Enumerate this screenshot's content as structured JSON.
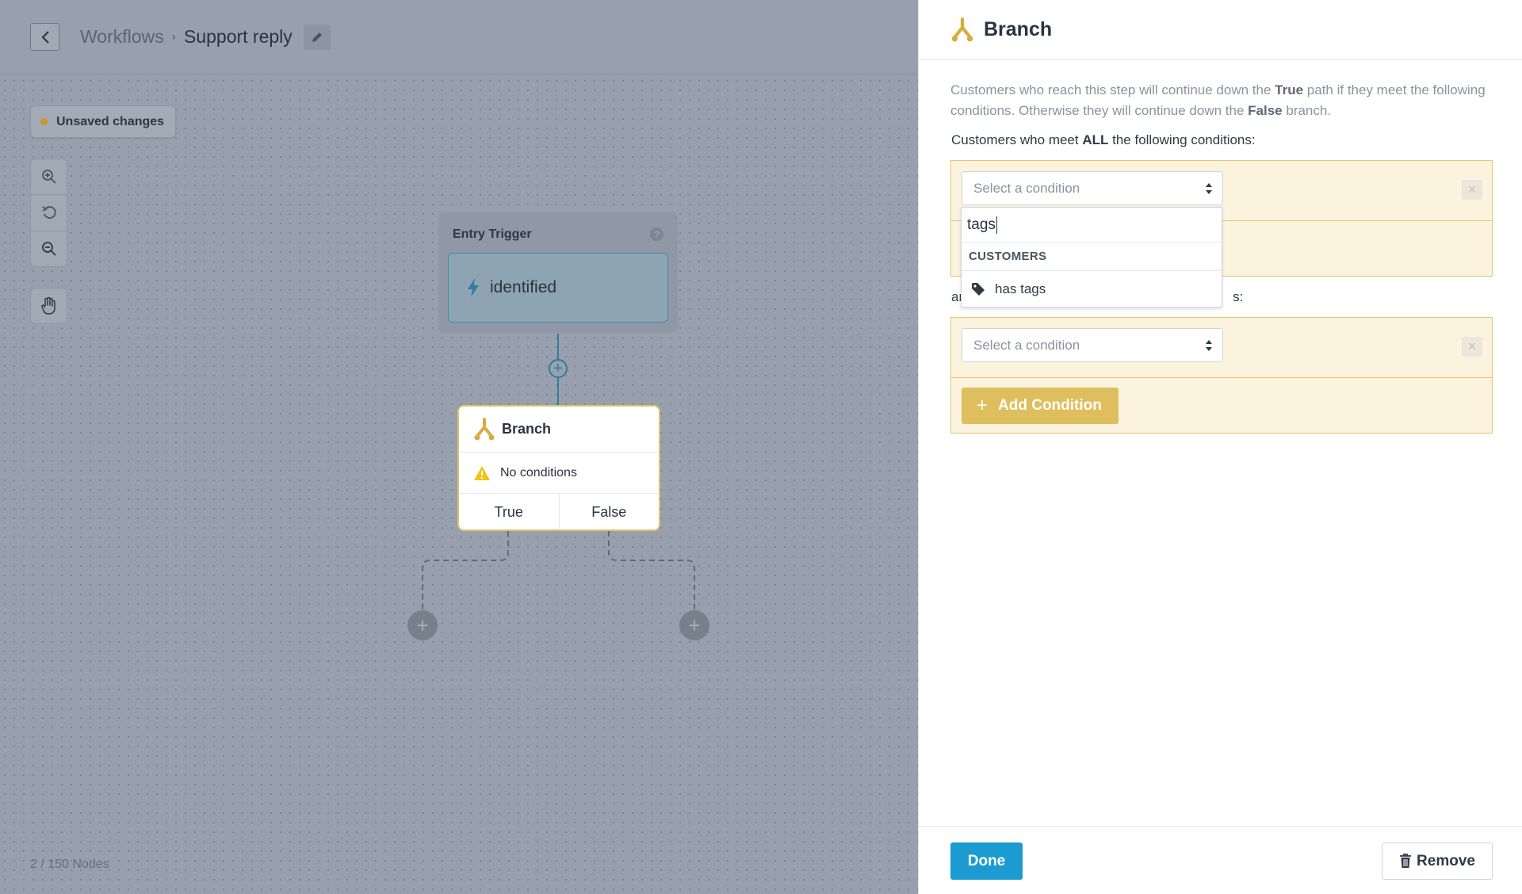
{
  "header": {
    "breadcrumb_parent": "Workflows",
    "breadcrumb_separator": "›",
    "title": "Support reply"
  },
  "canvas": {
    "unsaved_label": "Unsaved changes",
    "node_count": "2 / 150 Nodes",
    "entry_trigger": {
      "title": "Entry Trigger",
      "help": "?",
      "event": "identified"
    },
    "branch_node": {
      "title": "Branch",
      "status": "No conditions",
      "true_label": "True",
      "false_label": "False"
    },
    "add_plus": "+"
  },
  "panel": {
    "title": "Branch",
    "description_parts": {
      "p1": "Customers who reach this step will continue down the ",
      "b1": "True",
      "p2": " path if they meet the following conditions. Otherwise they will continue down the ",
      "b2": "False",
      "p3": " branch."
    },
    "all_label_pre": "Customers who meet ",
    "all_label_bold": "ALL",
    "all_label_post": " the following conditions:",
    "any_label_start": "ar",
    "any_label_end": "s:",
    "select_placeholder": "Select a condition",
    "remove_x": "×",
    "add_condition_plus": "+",
    "add_condition_label": "Add Condition",
    "dropdown": {
      "search_value": "tags",
      "group_label": "CUSTOMERS",
      "item_label": "has tags"
    },
    "done_label": "Done",
    "remove_label": "Remove"
  },
  "colors": {
    "accent_blue": "#1b9bd1",
    "branch_gold": "#dfbe5d",
    "warning_yellow": "#f0c419",
    "connector_teal": "#2f7da0"
  },
  "icons": [
    "chevron-left-icon",
    "pencil-icon",
    "zoom-in-icon",
    "reset-icon",
    "zoom-out-icon",
    "hand-icon",
    "lightning-icon",
    "branch-icon",
    "warning-icon",
    "tag-icon",
    "trash-icon",
    "sort-arrows-icon"
  ]
}
